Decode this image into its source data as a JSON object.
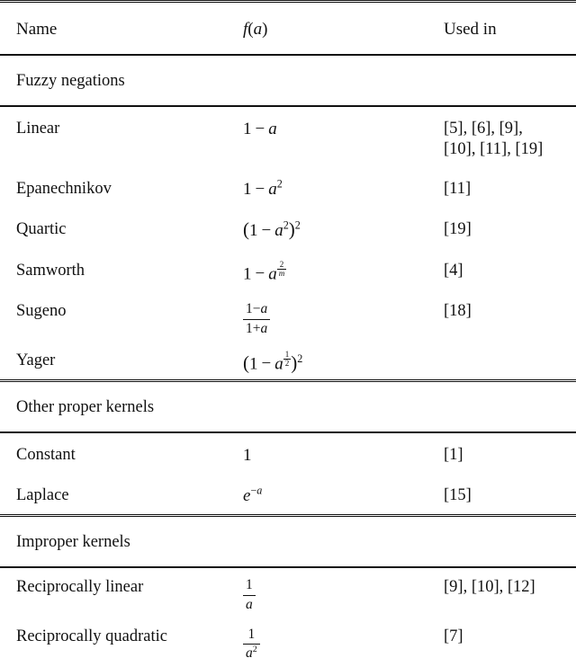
{
  "document": {
    "type": "academic-table",
    "columns": [
      "Name",
      "f(a)",
      "Used in"
    ],
    "header": {
      "name": "Name",
      "fa": "f(a)",
      "used_in": "Used in"
    },
    "sections": [
      {
        "title": "Fuzzy negations",
        "rows": [
          {
            "name": "Linear",
            "formula_text": "1 - a",
            "used_in": "[5],   [6],   [9],\n[10], [11], [19]"
          },
          {
            "name": "Epanechnikov",
            "formula_text": "1 - a^2",
            "used_in": "[11]"
          },
          {
            "name": "Quartic",
            "formula_text": "(1 - a^2)^2",
            "used_in": "[19]"
          },
          {
            "name": "Samworth",
            "formula_text": "1 - a^(2/m)",
            "used_in": "[4]"
          },
          {
            "name": "Sugeno",
            "formula_text": "(1-a)/(1+a)",
            "used_in": "[18]"
          },
          {
            "name": "Yager",
            "formula_text": "(1 - a^(1/2))^2",
            "used_in": ""
          }
        ]
      },
      {
        "title": "Other proper kernels",
        "rows": [
          {
            "name": "Constant",
            "formula_text": "1",
            "used_in": "[1]"
          },
          {
            "name": "Laplace",
            "formula_text": "e^-a",
            "used_in": "[15]"
          }
        ]
      },
      {
        "title": "Improper kernels",
        "rows": [
          {
            "name": "Reciprocally linear",
            "formula_text": "1/a",
            "used_in": "[9], [10], [12]"
          },
          {
            "name": "Reciprocally quadratic",
            "formula_text": "1/a^2",
            "used_in": "[7]"
          }
        ]
      }
    ],
    "math_symbols": {
      "variable": "a",
      "exponent_m": "m",
      "euler": "e",
      "one": "1",
      "two": "2",
      "minus": "−",
      "plus": "+"
    }
  }
}
